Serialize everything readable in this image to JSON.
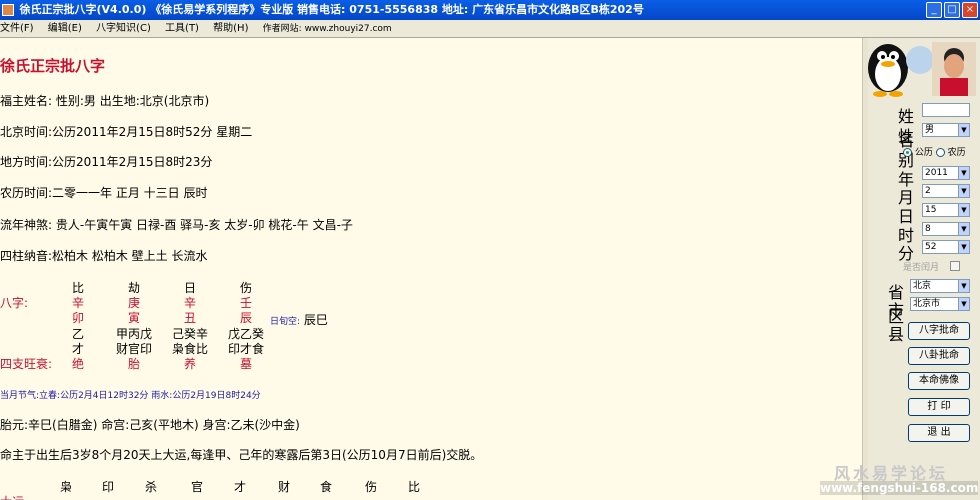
{
  "window": {
    "title": "徐氏正宗批八字(V4.0.0)  《徐氏易学系列程序》专业版  销售电话: 0751-5556838  地址: 广东省乐昌市文化路B区B栋202号",
    "minimize": "_",
    "maximize": "□",
    "close": "×"
  },
  "menu": {
    "file": "文件(F)",
    "edit": "编辑(E)",
    "bazi": "八字知识(C)",
    "tools": "工具(T)",
    "help": "帮助(H)",
    "website": "作者网站: www.zhouyi27.com"
  },
  "report": {
    "title": "徐氏正宗批八字",
    "owner": "福主姓名:  性别:男  出生地:北京(北京市)",
    "beijing_time": "北京时间:公历2011年2月15日8时52分 星期二",
    "local_time": "地方时间:公历2011年2月15日8时23分",
    "lunar_time": "农历时间:二零一一年 正月 十三日 辰时",
    "shensha": "流年神煞:  贵人-午寅午寅 日禄-酉 驿马-亥 太岁-卯 桃花-午 文昌-子",
    "nayin": "四柱纳音:松柏木    松柏木    壁上土    长流水",
    "bazi_label": "八字:",
    "twelve_label": "四支旺衰:",
    "xunkong_label": "日旬空:",
    "xunkong_value": "辰巳",
    "pillars": [
      {
        "god": "比",
        "stem": "辛",
        "branch": "卯",
        "hidden": "乙",
        "hidden_god": "才",
        "state": "绝"
      },
      {
        "god": "劫",
        "stem": "庚",
        "branch": "寅",
        "hidden": "甲丙戊",
        "hidden_god": "财官印",
        "state": "胎"
      },
      {
        "god": "日",
        "stem": "辛",
        "branch": "丑",
        "hidden": "己癸辛",
        "hidden_god": "枭食比",
        "state": "养"
      },
      {
        "god": "伤",
        "stem": "壬",
        "branch": "辰",
        "hidden": "戊乙癸",
        "hidden_god": "印才食",
        "state": "墓"
      }
    ],
    "jieqi": "当月节气:立春:公历2月4日12时32分  雨水:公历2月19日8时24分",
    "taiyuan": "胎元:辛巳(白腊金)  命宫:己亥(平地木)  身宫:乙未(沙中金)",
    "dayun_note": "命主于出生后3岁8个月20天上大运,每逢甲、己年的寒露后第3日(公历10月7日前后)交脱。",
    "dayun_label": "大运",
    "dayun_gods": [
      "枭",
      "印",
      "杀",
      "官",
      "才",
      "财",
      "食",
      "伤",
      "比"
    ]
  },
  "panel": {
    "name_label": "姓名",
    "name_value": "",
    "gender_label": "性别",
    "gender_value": "男",
    "calendar_solar": "公历",
    "calendar_lunar": "农历",
    "year_label": "年",
    "year_value": "2011",
    "month_label": "月",
    "month_value": "2",
    "day_label": "日",
    "day_value": "15",
    "hour_label": "时",
    "hour_value": "8",
    "minute_label": "分",
    "minute_value": "52",
    "leap_label": "是否闰月",
    "province_label": "省区",
    "province_value": "北京",
    "city_label": "市县",
    "city_value": "北京市",
    "btn_bazi": "八字批命",
    "btn_bagua": "八卦批命",
    "btn_benming": "本命佛像",
    "btn_print": "打 印",
    "btn_exit": "退 出"
  },
  "watermark": {
    "text": "风水易学论坛",
    "url": "www.fengshui-168.com"
  }
}
